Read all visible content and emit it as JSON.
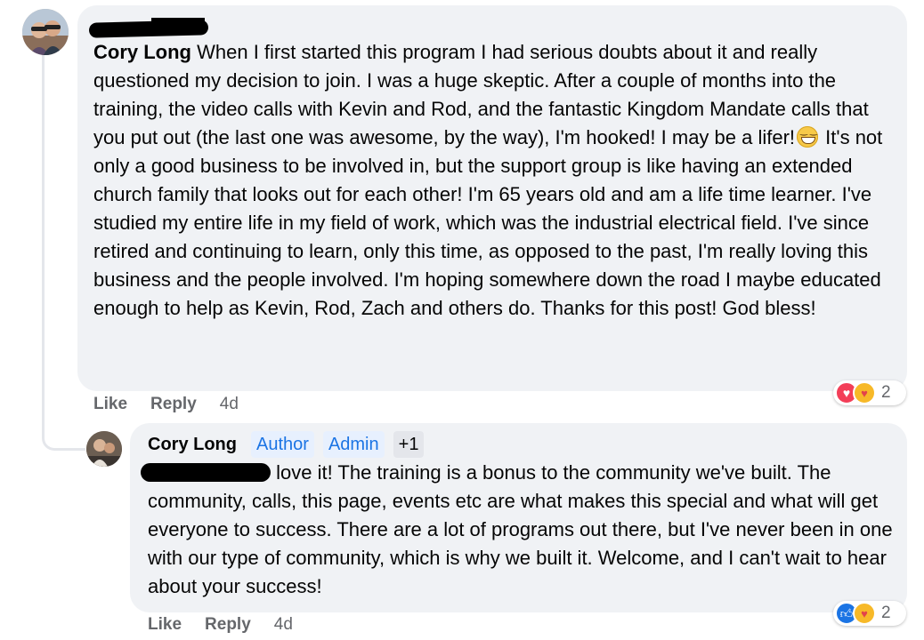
{
  "comments": [
    {
      "author": "Cory Long",
      "text": " When I first started this program I had serious doubts about it and really questioned my decision to join. I was a huge skeptic. After a couple of months into the training, the video calls with Kevin and Rod, and the fantastic Kingdom Mandate calls that you put out (the last one was awesome, by the way), I'm hooked! I may be a lifer!",
      "text_after_emoji": " It's not only a good business to be involved in, but the support group is like having an extended church family that looks out for each other! I'm 65 years old and am a life time learner. I've studied my entire life in my field of work, which was the industrial electrical field. I've since retired and continuing to learn, only this time, as opposed to the past, I'm really loving this business and the people involved. I'm hoping somewhere down the road I maybe educated enough to help as Kevin, Rod, Zach and others do. Thanks for this post! God bless!",
      "emoji": "grinning-face-icon",
      "actions": {
        "like": "Like",
        "reply": "Reply",
        "time": "4d"
      },
      "reactions": {
        "icons": [
          "love-icon",
          "care-icon"
        ],
        "count": "2"
      }
    },
    {
      "author": "Cory Long",
      "badges": [
        "Author",
        "Admin",
        "+1"
      ],
      "text": " love it! The training is a bonus to the community we've built. The community, calls, this page, events etc are what makes this special and what will get everyone to success. There are a lot of programs out there, but I've never been in one with our type of community, which is why we built it. Welcome, and I can't wait to hear about your success!",
      "actions": {
        "like": "Like",
        "reply": "Reply",
        "time": "4d"
      },
      "reactions": {
        "icons": [
          "like-icon",
          "care-icon"
        ],
        "count": "2"
      }
    }
  ],
  "colors": {
    "bubble": "#f0f2f5",
    "meta_text": "#65676b",
    "badge_bg": "#e7f0fe",
    "badge_text": "#1b74e4",
    "love": "#f33e58",
    "like": "#1b74e4",
    "care": "#f7b928"
  }
}
